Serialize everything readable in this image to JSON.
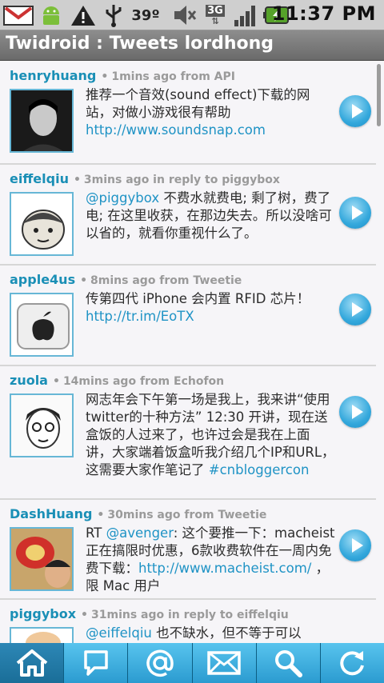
{
  "status_bar": {
    "temperature": "39º",
    "network": "3G",
    "time": "11:37 PM"
  },
  "header": {
    "title": "Twidroid : Tweets lordhong"
  },
  "tweets": [
    {
      "user": "henryhuang",
      "meta": "1mins ago  from API",
      "text": "推荐一个音效(sound effect)下载的网站，对做小游戏很有帮助 ",
      "link": "http://www.soundsnap.com",
      "text_after": ""
    },
    {
      "user": "eiffelqiu",
      "meta": "3mins ago  in reply to piggybox",
      "mention": "@piggybox",
      "text": " 不费水就费电; 剩了树，费了电; 在这里收获，在那边失去。所以没啥可以省的，就看你重视什么了。"
    },
    {
      "user": "apple4us",
      "meta": "8mins ago  from Tweetie",
      "text": "传第四代 iPhone 会内置 RFID 芯片！",
      "link": "http://tr.im/EoTX",
      "text_after": ""
    },
    {
      "user": "zuola",
      "meta": "14mins ago  from Echofon",
      "text": "网志年会下午第一场是我上，我来讲“使用twitter的十种方法” 12:30 开讲，现在送盒饭的人过来了，也许过会是我在上面讲，大家端着饭盒听我介绍几个IP和URL，这需要大家作笔记了 ",
      "link": "#cnbloggercon",
      "text_after": ""
    },
    {
      "user": "DashHuang",
      "meta": "30mins ago  from Tweetie",
      "text_before": "RT ",
      "mention": "@avenger",
      "text": ": 这个要推一下：macheist正在搞限时优惠，6款收费软件在一周内免费下载：",
      "link": "http://www.macheist.com/",
      "text_after": " ，限 Mac 用户"
    },
    {
      "user": "piggybox",
      "meta": "31mins ago  in reply to eiffelqiu",
      "mention": "@eiffelqiu",
      "text": " 也不缺水，但不等于可以"
    }
  ],
  "icons": {
    "status": [
      "gmail-icon",
      "android-icon",
      "warning-icon",
      "usb-icon",
      "mute-icon",
      "3g-icon",
      "signal-icon",
      "battery-icon"
    ],
    "tabs": [
      "home-icon",
      "message-icon",
      "at-mention-icon",
      "mail-icon",
      "search-icon",
      "refresh-icon"
    ]
  },
  "colors": {
    "accent": "#1a8fb6",
    "tab": "#3aaee0",
    "active_tab": "#1f78a6"
  }
}
